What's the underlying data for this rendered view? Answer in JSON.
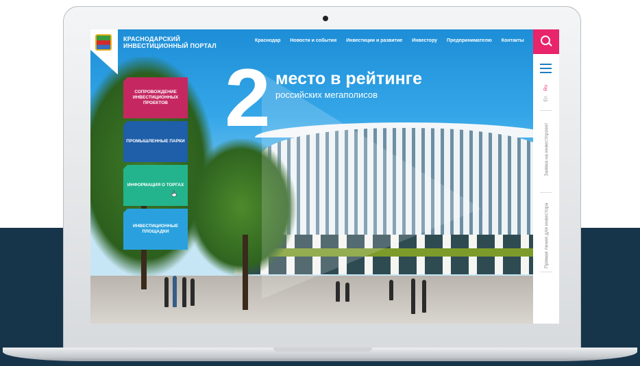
{
  "header": {
    "portal_title": "КРАСНОДАРСКИЙ ИНВЕСТИЦИОННЫЙ ПОРТАЛ",
    "nav": [
      "Краснодар",
      "Новости и события",
      "Инвестиции и развитие",
      "Инвестору",
      "Предпринимателю",
      "Контакты"
    ]
  },
  "hero": {
    "number": "2",
    "title": "место в рейтинге",
    "subtitle": "российских мегаполисов"
  },
  "tiles": [
    "СОПРОВОЖДЕНИЕ ИНВЕСТИЦИОННЫХ ПРОЕКТОВ",
    "ПРОМЫШЛЕННЫЕ ПАРКИ",
    "ИНФОРМАЦИЯ О ТОРГАХ",
    "ИНВЕСТИЦИОННЫЕ ПЛОЩАДКИ"
  ],
  "rail": {
    "lang_ru": "Ru",
    "lang_en": "En",
    "link_1": "Заявка на инвестпроект",
    "link_2": "Прямая линия для инвестора"
  },
  "colors": {
    "accent": "#e8246a",
    "tile_1": "#c52860",
    "tile_2": "#1f5ea8",
    "tile_3": "#23b48d",
    "tile_4": "#2aa1de",
    "backdrop": "#17354a"
  },
  "icons": {
    "search": "search-icon",
    "menu": "hamburger-menu-icon",
    "cursor": "hand-cursor-icon",
    "crest": "coat-of-arms-icon"
  }
}
